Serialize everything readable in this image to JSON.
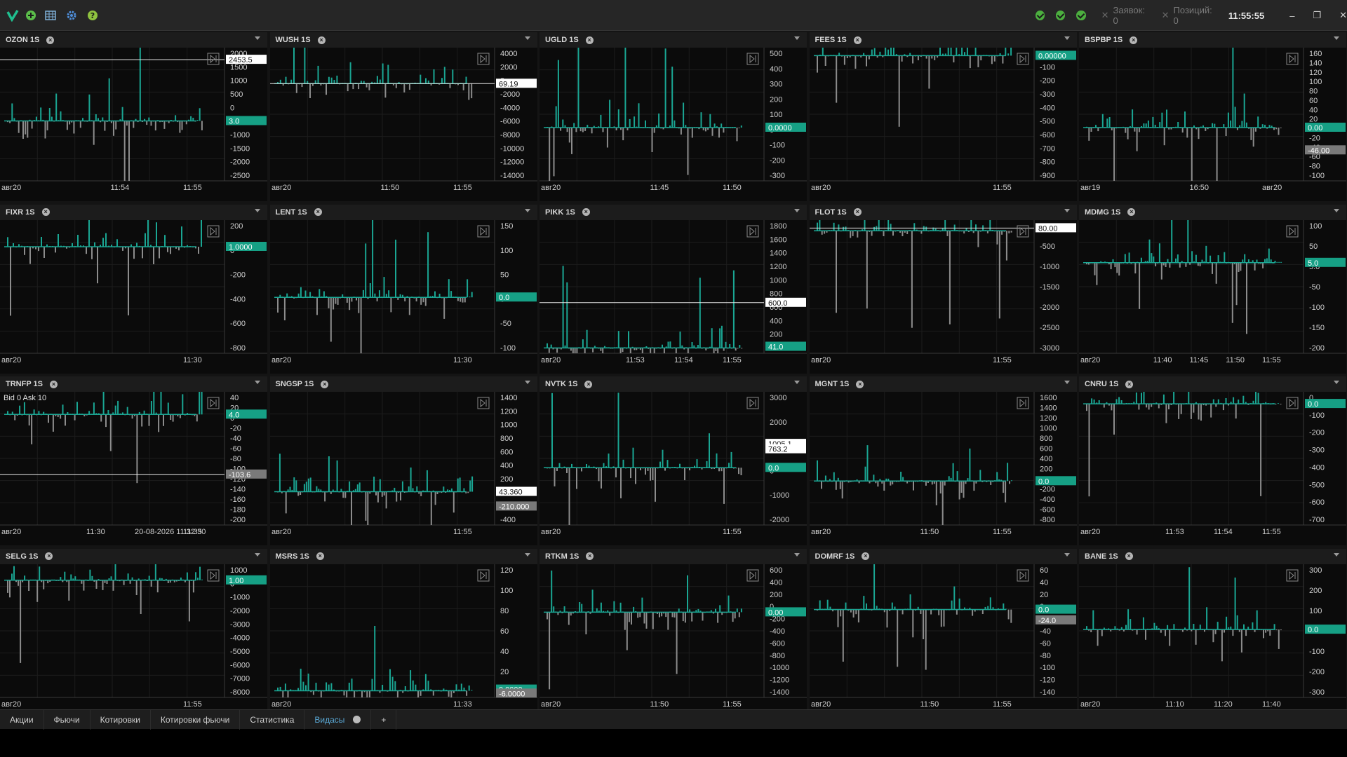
{
  "topbar": {
    "clock": "11:55:55",
    "orders_label": "Заявок: 0",
    "positions_label": "Позиций: 0",
    "icons": [
      "logo-check-icon",
      "plus-circle-icon",
      "table-icon",
      "gear-icon",
      "help-icon"
    ]
  },
  "colors": {
    "teal": "#1aa693",
    "gray": "#8c8c8c",
    "badge": "#16a085"
  },
  "tabs": [
    {
      "label": "Акции"
    },
    {
      "label": "Фьючи"
    },
    {
      "label": "Котировки"
    },
    {
      "label": "Котировки фьючи"
    },
    {
      "label": "Статистика"
    },
    {
      "label": "Видасы",
      "active": true
    },
    {
      "label": "+"
    }
  ],
  "panels": [
    {
      "title": "OZON 1S",
      "y": [
        "2000",
        "1500",
        "1000",
        "500",
        "0",
        "-500",
        "-1000",
        "-1500",
        "-2000",
        "-2500"
      ],
      "x": [
        "авг20",
        "11:54",
        "11:55"
      ],
      "tags": [
        {
          "t": "2453.5",
          "c": "w",
          "p": 0.09
        },
        {
          "t": "3.0",
          "c": "t",
          "p": 0.55
        }
      ],
      "base": 0.55,
      "hline": 0.09
    },
    {
      "title": "WUSH 1S",
      "y": [
        "4000",
        "2000",
        "0",
        "-2000",
        "-4000",
        "-6000",
        "-8000",
        "-10000",
        "-12000",
        "-14000"
      ],
      "x": [
        "авг20",
        "11:50",
        "11:55"
      ],
      "tags": [
        {
          "t": "69.19",
          "c": "w",
          "p": 0.27
        }
      ],
      "base": 0.27,
      "hline": 0.27
    },
    {
      "title": "UGLD 1S",
      "y": [
        "500",
        "400",
        "300",
        "200",
        "100",
        "0",
        "-100",
        "-200",
        "-300"
      ],
      "x": [
        "авг20",
        "11:45",
        "11:50"
      ],
      "tags": [
        {
          "t": "0.0000",
          "c": "t",
          "p": 0.6
        }
      ],
      "base": 0.6
    },
    {
      "title": "FEES 1S",
      "y": [
        "0",
        "-100",
        "-200",
        "-300",
        "-400",
        "-500",
        "-600",
        "-700",
        "-800",
        "-900"
      ],
      "x": [
        "авг20",
        "11:55"
      ],
      "tags": [
        {
          "t": "0.00000",
          "c": "t",
          "p": 0.06
        }
      ],
      "base": 0.06
    },
    {
      "title": "BSPBP 1S",
      "y": [
        "160",
        "140",
        "120",
        "100",
        "80",
        "60",
        "40",
        "20",
        "0",
        "-20",
        "-40",
        "-60",
        "-80",
        "-100"
      ],
      "x": [
        "авг19",
        "16:50",
        "авг20"
      ],
      "tags": [
        {
          "t": "0.00",
          "c": "t",
          "p": 0.6
        },
        {
          "t": "-46.00",
          "c": "g",
          "p": 0.77
        }
      ],
      "base": 0.6
    },
    {
      "title": "FIXR 1S",
      "y": [
        "200",
        "0",
        "-200",
        "-400",
        "-600",
        "-800"
      ],
      "x": [
        "авг20",
        "11:30"
      ],
      "tags": [
        {
          "t": "1.0000",
          "c": "t",
          "p": 0.2
        }
      ],
      "base": 0.2
    },
    {
      "title": "LENT 1S",
      "y": [
        "150",
        "100",
        "50",
        "0",
        "-50",
        "-100"
      ],
      "x": [
        "авг20",
        "11:30"
      ],
      "tags": [
        {
          "t": "0.0",
          "c": "t",
          "p": 0.58
        }
      ],
      "base": 0.58
    },
    {
      "title": "PIKK 1S",
      "y": [
        "1800",
        "1600",
        "1400",
        "1200",
        "1000",
        "800",
        "600",
        "400",
        "200",
        "0"
      ],
      "x": [
        "авг20",
        "11:53",
        "11:54",
        "11:55"
      ],
      "tags": [
        {
          "t": "600.0",
          "c": "w",
          "p": 0.62
        },
        {
          "t": "41.0",
          "c": "t",
          "p": 0.95
        }
      ],
      "base": 0.96,
      "hline": 0.62
    },
    {
      "title": "FLOT 1S",
      "y": [
        "0",
        "-500",
        "-1000",
        "-1500",
        "-2000",
        "-2500",
        "-3000"
      ],
      "x": [
        "авг20",
        "11:55"
      ],
      "tags": [
        {
          "t": "80.00",
          "c": "w",
          "p": 0.06
        }
      ],
      "base": 0.08,
      "hline": 0.06
    },
    {
      "title": "MDMG 1S",
      "y": [
        "100",
        "50",
        "5.0",
        "-50",
        "-100",
        "-150",
        "-200"
      ],
      "x": [
        "авг20",
        "11:40",
        "11:45",
        "11:50",
        "11:55"
      ],
      "tags": [
        {
          "t": "5.0",
          "c": "t",
          "p": 0.32
        }
      ],
      "base": 0.32
    },
    {
      "title": "TRNFP 1S",
      "y": [
        "40",
        "20",
        "0",
        "-20",
        "-40",
        "-60",
        "-80",
        "-100",
        "-120",
        "-140",
        "-160",
        "-180",
        "-200"
      ],
      "x": [
        "авг20",
        "11:30",
        "20-08-2026 11:32:30",
        "11:35"
      ],
      "tags": [
        {
          "t": "4.0",
          "c": "t",
          "p": 0.17
        },
        {
          "t": "-103.6",
          "c": "g",
          "p": 0.62
        }
      ],
      "base": 0.17,
      "hline": 0.62,
      "note": "Bid 0 Ask 10"
    },
    {
      "title": "SNGSP 1S",
      "y": [
        "1400",
        "1200",
        "1000",
        "800",
        "600",
        "400",
        "200",
        "0",
        "-200",
        "-400"
      ],
      "x": [
        "авг20",
        "11:55"
      ],
      "tags": [
        {
          "t": "43.360",
          "c": "w",
          "p": 0.75
        },
        {
          "t": "-210.000",
          "c": "g",
          "p": 0.86
        }
      ],
      "base": 0.75
    },
    {
      "title": "NVTK 1S",
      "y": [
        "3000",
        "2000",
        "1000",
        "0",
        "-1000",
        "-2000"
      ],
      "x": [
        "авг20",
        "11:55"
      ],
      "tags": [
        {
          "t": "1005.1",
          "c": "w",
          "p": 0.39
        },
        {
          "t": "763.2",
          "c": "w",
          "p": 0.43
        },
        {
          "t": "0.0",
          "c": "t",
          "p": 0.57
        }
      ],
      "base": 0.57
    },
    {
      "title": "MGNT 1S",
      "y": [
        "1600",
        "1400",
        "1200",
        "1000",
        "800",
        "600",
        "400",
        "200",
        "0",
        "-200",
        "-400",
        "-600",
        "-800"
      ],
      "x": [
        "авг20",
        "11:50",
        "11:55"
      ],
      "tags": [
        {
          "t": "0.0",
          "c": "t",
          "p": 0.67
        }
      ],
      "base": 0.67
    },
    {
      "title": "CNRU 1S",
      "y": [
        "0",
        "-100",
        "-200",
        "-300",
        "-400",
        "-500",
        "-600",
        "-700"
      ],
      "x": [
        "авг20",
        "11:53",
        "11:54",
        "11:55"
      ],
      "tags": [
        {
          "t": "0.0",
          "c": "t",
          "p": 0.09
        }
      ],
      "base": 0.09
    },
    {
      "title": "SELG 1S",
      "y": [
        "1000",
        "0",
        "-1000",
        "-2000",
        "-3000",
        "-4000",
        "-5000",
        "-6000",
        "-7000",
        "-8000"
      ],
      "x": [
        "авг20",
        "11:55"
      ],
      "tags": [
        {
          "t": "1.00",
          "c": "t",
          "p": 0.12
        }
      ],
      "base": 0.12
    },
    {
      "title": "MSRS 1S",
      "y": [
        "120",
        "100",
        "80",
        "60",
        "40",
        "20",
        "0"
      ],
      "x": [
        "авг20",
        "11:33"
      ],
      "tags": [
        {
          "t": "0.0000",
          "c": "t",
          "p": 0.94
        },
        {
          "t": "-6.0000",
          "c": "g",
          "p": 0.97
        }
      ],
      "base": 0.95
    },
    {
      "title": "RTKM 1S",
      "y": [
        "600",
        "400",
        "200",
        "0",
        "-200",
        "-400",
        "-600",
        "-800",
        "-1000",
        "-1200",
        "-1400"
      ],
      "x": [
        "авг20",
        "11:50",
        "11:55"
      ],
      "tags": [
        {
          "t": "0.00",
          "c": "t",
          "p": 0.36
        }
      ],
      "base": 0.36
    },
    {
      "title": "DOMRF 1S",
      "y": [
        "60",
        "40",
        "20",
        "0",
        "-20",
        "-40",
        "-60",
        "-80",
        "-100",
        "-120",
        "-140"
      ],
      "x": [
        "авг20",
        "11:50",
        "11:55"
      ],
      "tags": [
        {
          "t": "0.0",
          "c": "t",
          "p": 0.34
        },
        {
          "t": "-24.0",
          "c": "g",
          "p": 0.42
        }
      ],
      "base": 0.34
    },
    {
      "title": "BANE 1S",
      "y": [
        "300",
        "200",
        "100",
        "0",
        "-100",
        "-200",
        "-300"
      ],
      "x": [
        "авг20",
        "11:10",
        "11:20",
        "11:40"
      ],
      "tags": [
        {
          "t": "0.0",
          "c": "t",
          "p": 0.49
        }
      ],
      "base": 0.49
    }
  ]
}
